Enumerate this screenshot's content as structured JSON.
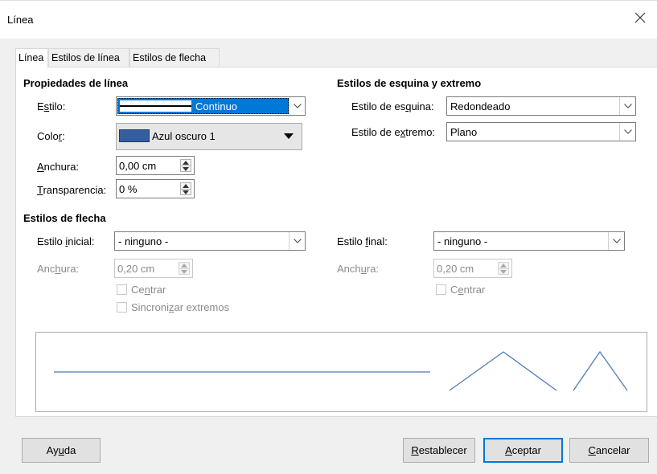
{
  "window": {
    "title": "Línea",
    "close_glyph": "✕"
  },
  "tabs": [
    {
      "label": "Línea"
    },
    {
      "label": "Estilos de línea"
    },
    {
      "label": "Estilos de flecha"
    }
  ],
  "line_properties": {
    "heading": "Propiedades de línea",
    "style_label_pre": "E",
    "style_label_u": "s",
    "style_label_post": "tilo:",
    "style_value": "Continuo",
    "color_label_pre": "Colo",
    "color_label_u": "r",
    "color_label_post": ":",
    "color_value": "Azul oscuro 1",
    "color_swatch": "#355e9e",
    "width_label_u": "A",
    "width_label_post": "nchura:",
    "width_value": "0,00 cm",
    "transparency_label_u": "T",
    "transparency_label_post": "ransparencia:",
    "transparency_value": "0 %"
  },
  "corner_cap": {
    "heading": "Estilos de esquina y extremo",
    "corner_label_pre": "Estilo de es",
    "corner_label_u": "q",
    "corner_label_post": "uina:",
    "corner_value": "Redondeado",
    "cap_label_pre": "Estilo de e",
    "cap_label_u": "x",
    "cap_label_post": "tremo:",
    "cap_value": "Plano"
  },
  "arrow_styles": {
    "heading": "Estilos de flecha",
    "start_label_pre": "Estilo ",
    "start_label_u": "i",
    "start_label_post": "nicial:",
    "start_value": "- ninguno -",
    "start_width_label_pre": "Anc",
    "start_width_label_u": "h",
    "start_width_label_post": "ura:",
    "start_width_value": "0,20 cm",
    "start_center_pre": "Ce",
    "start_center_u": "n",
    "start_center_post": "trar",
    "sync_pre": "Sincroni",
    "sync_u": "z",
    "sync_post": "ar extremos",
    "end_label_pre": "Estilo ",
    "end_label_u": "f",
    "end_label_post": "inal:",
    "end_value": "- ninguno -",
    "end_width_label_pre": "Anch",
    "end_width_label_u": "u",
    "end_width_label_post": "ra:",
    "end_width_value": "0,20 cm",
    "end_center_pre": "C",
    "end_center_u": "e",
    "end_center_post": "ntrar"
  },
  "preview": {
    "line_color": "#4f7bb5"
  },
  "buttons": {
    "help_pre": "Ay",
    "help_u": "u",
    "help_post": "da",
    "reset_u": "R",
    "reset_post": "establecer",
    "ok_u": "A",
    "ok_post": "ceptar",
    "cancel_u": "C",
    "cancel_post": "ancelar"
  },
  "accent_color": "#0078d7",
  "selection_color": "#0078d7"
}
